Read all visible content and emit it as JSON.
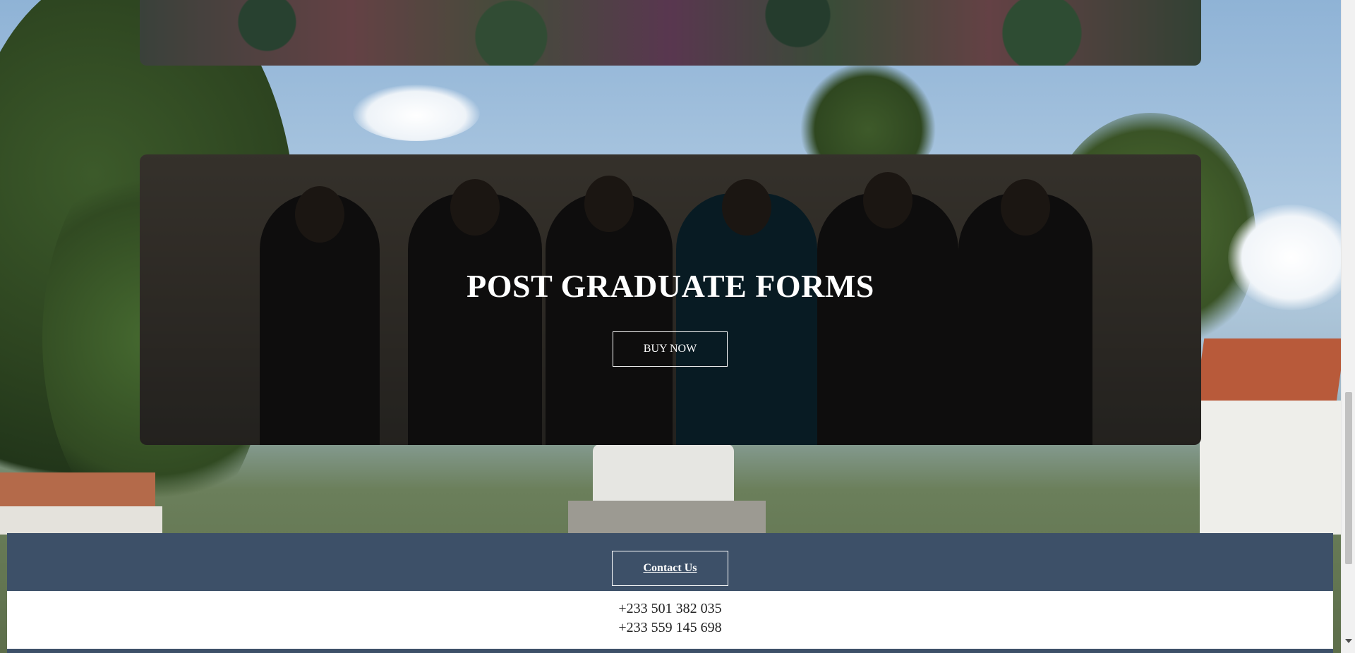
{
  "post_graduate": {
    "title": "POST GRADUATE FORMS",
    "button_label": "BUY NOW"
  },
  "footer": {
    "contact_label": "Contact Us",
    "phones": [
      "+233 501 382 035",
      "+233 559 145 698"
    ]
  },
  "colors": {
    "footer_band": "#3d5068",
    "button_border": "#ffffff",
    "text_on_dark": "#ffffff"
  }
}
